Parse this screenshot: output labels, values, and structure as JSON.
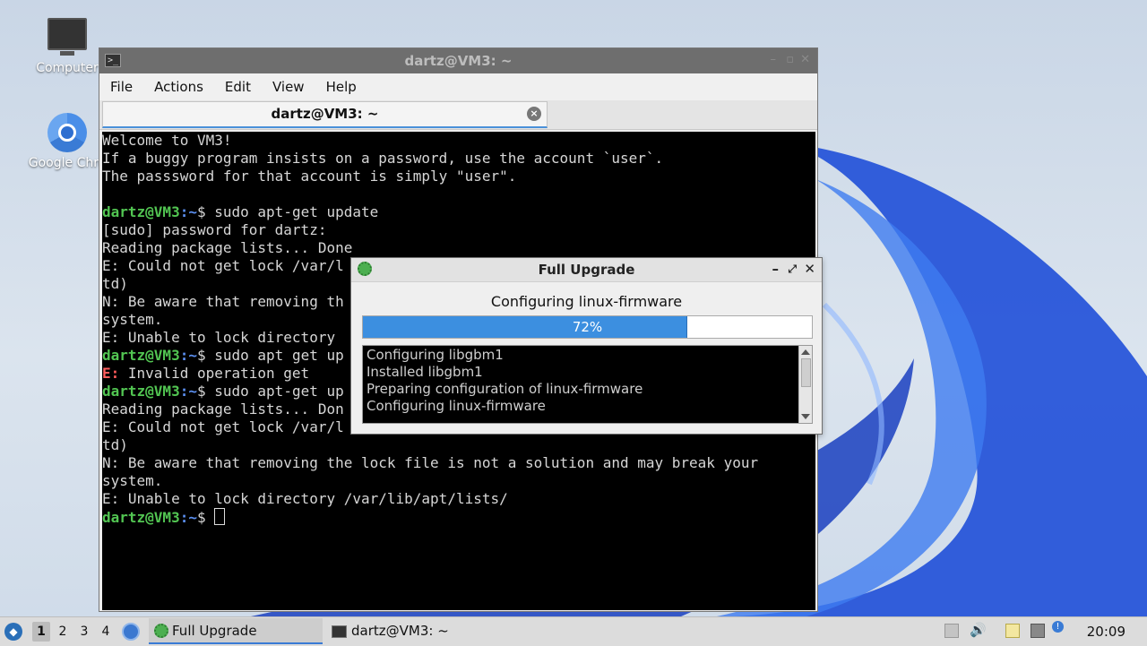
{
  "desktop": {
    "icons": [
      {
        "label": "Computer",
        "icon": "computer-icon"
      },
      {
        "label": "Google Chro",
        "icon": "chrome-icon"
      }
    ]
  },
  "terminal": {
    "title": "dartz@VM3: ~",
    "menu": [
      "File",
      "Actions",
      "Edit",
      "View",
      "Help"
    ],
    "tab_label": "dartz@VM3: ~",
    "prompt_user": "dartz@VM3",
    "prompt_path": "~",
    "lines": [
      {
        "type": "text",
        "text": "Welcome to VM3!"
      },
      {
        "type": "text",
        "text": "If a buggy program insists on a password, use the account `user`."
      },
      {
        "type": "text",
        "text": "The passsword for that account is simply \"user\"."
      },
      {
        "type": "text",
        "text": ""
      },
      {
        "type": "prompt",
        "text": "$ sudo apt-get update"
      },
      {
        "type": "text",
        "text": "[sudo] password for dartz:"
      },
      {
        "type": "text",
        "text": "Reading package lists... Done"
      },
      {
        "type": "text",
        "text": "E: Could not get lock /var/l"
      },
      {
        "type": "text",
        "text": "td)"
      },
      {
        "type": "text",
        "text": "N: Be aware that removing th"
      },
      {
        "type": "text",
        "text": "system."
      },
      {
        "type": "text",
        "text": "E: Unable to lock directory"
      },
      {
        "type": "prompt",
        "text": "$ sudo apt get up"
      },
      {
        "type": "error",
        "prefix": "E:",
        "text": " Invalid operation get"
      },
      {
        "type": "prompt",
        "text": "$ sudo apt-get up"
      },
      {
        "type": "text",
        "text": "Reading package lists... Don"
      },
      {
        "type": "text",
        "text": "E: Could not get lock /var/l"
      },
      {
        "type": "text",
        "text": "td)"
      },
      {
        "type": "text",
        "text": "N: Be aware that removing the lock file is not a solution and may break your"
      },
      {
        "type": "text",
        "text": "system."
      },
      {
        "type": "text",
        "text": "E: Unable to lock directory /var/lib/apt/lists/"
      },
      {
        "type": "prompt",
        "text": "$ ",
        "cursor": true
      }
    ]
  },
  "dialog": {
    "title": "Full Upgrade",
    "message": "Configuring linux-firmware",
    "progress": 72,
    "progress_label": "72%",
    "log": [
      "Configuring libgbm1",
      "Installed libgbm1",
      "Preparing configuration of linux-firmware",
      "Configuring linux-firmware"
    ]
  },
  "taskbar": {
    "workspaces": [
      "1",
      "2",
      "3",
      "4"
    ],
    "active_workspace": 0,
    "tasks": [
      {
        "label": "Full Upgrade",
        "icon": "gear-icon",
        "active": true
      },
      {
        "label": "dartz@VM3: ~",
        "icon": "terminal-icon",
        "active": false
      }
    ],
    "clock": "20:09"
  },
  "colors": {
    "accent": "#3c8fe0",
    "prompt_user": "#52c552",
    "prompt_path": "#5b8ff0",
    "error": "#ff5c5c"
  }
}
